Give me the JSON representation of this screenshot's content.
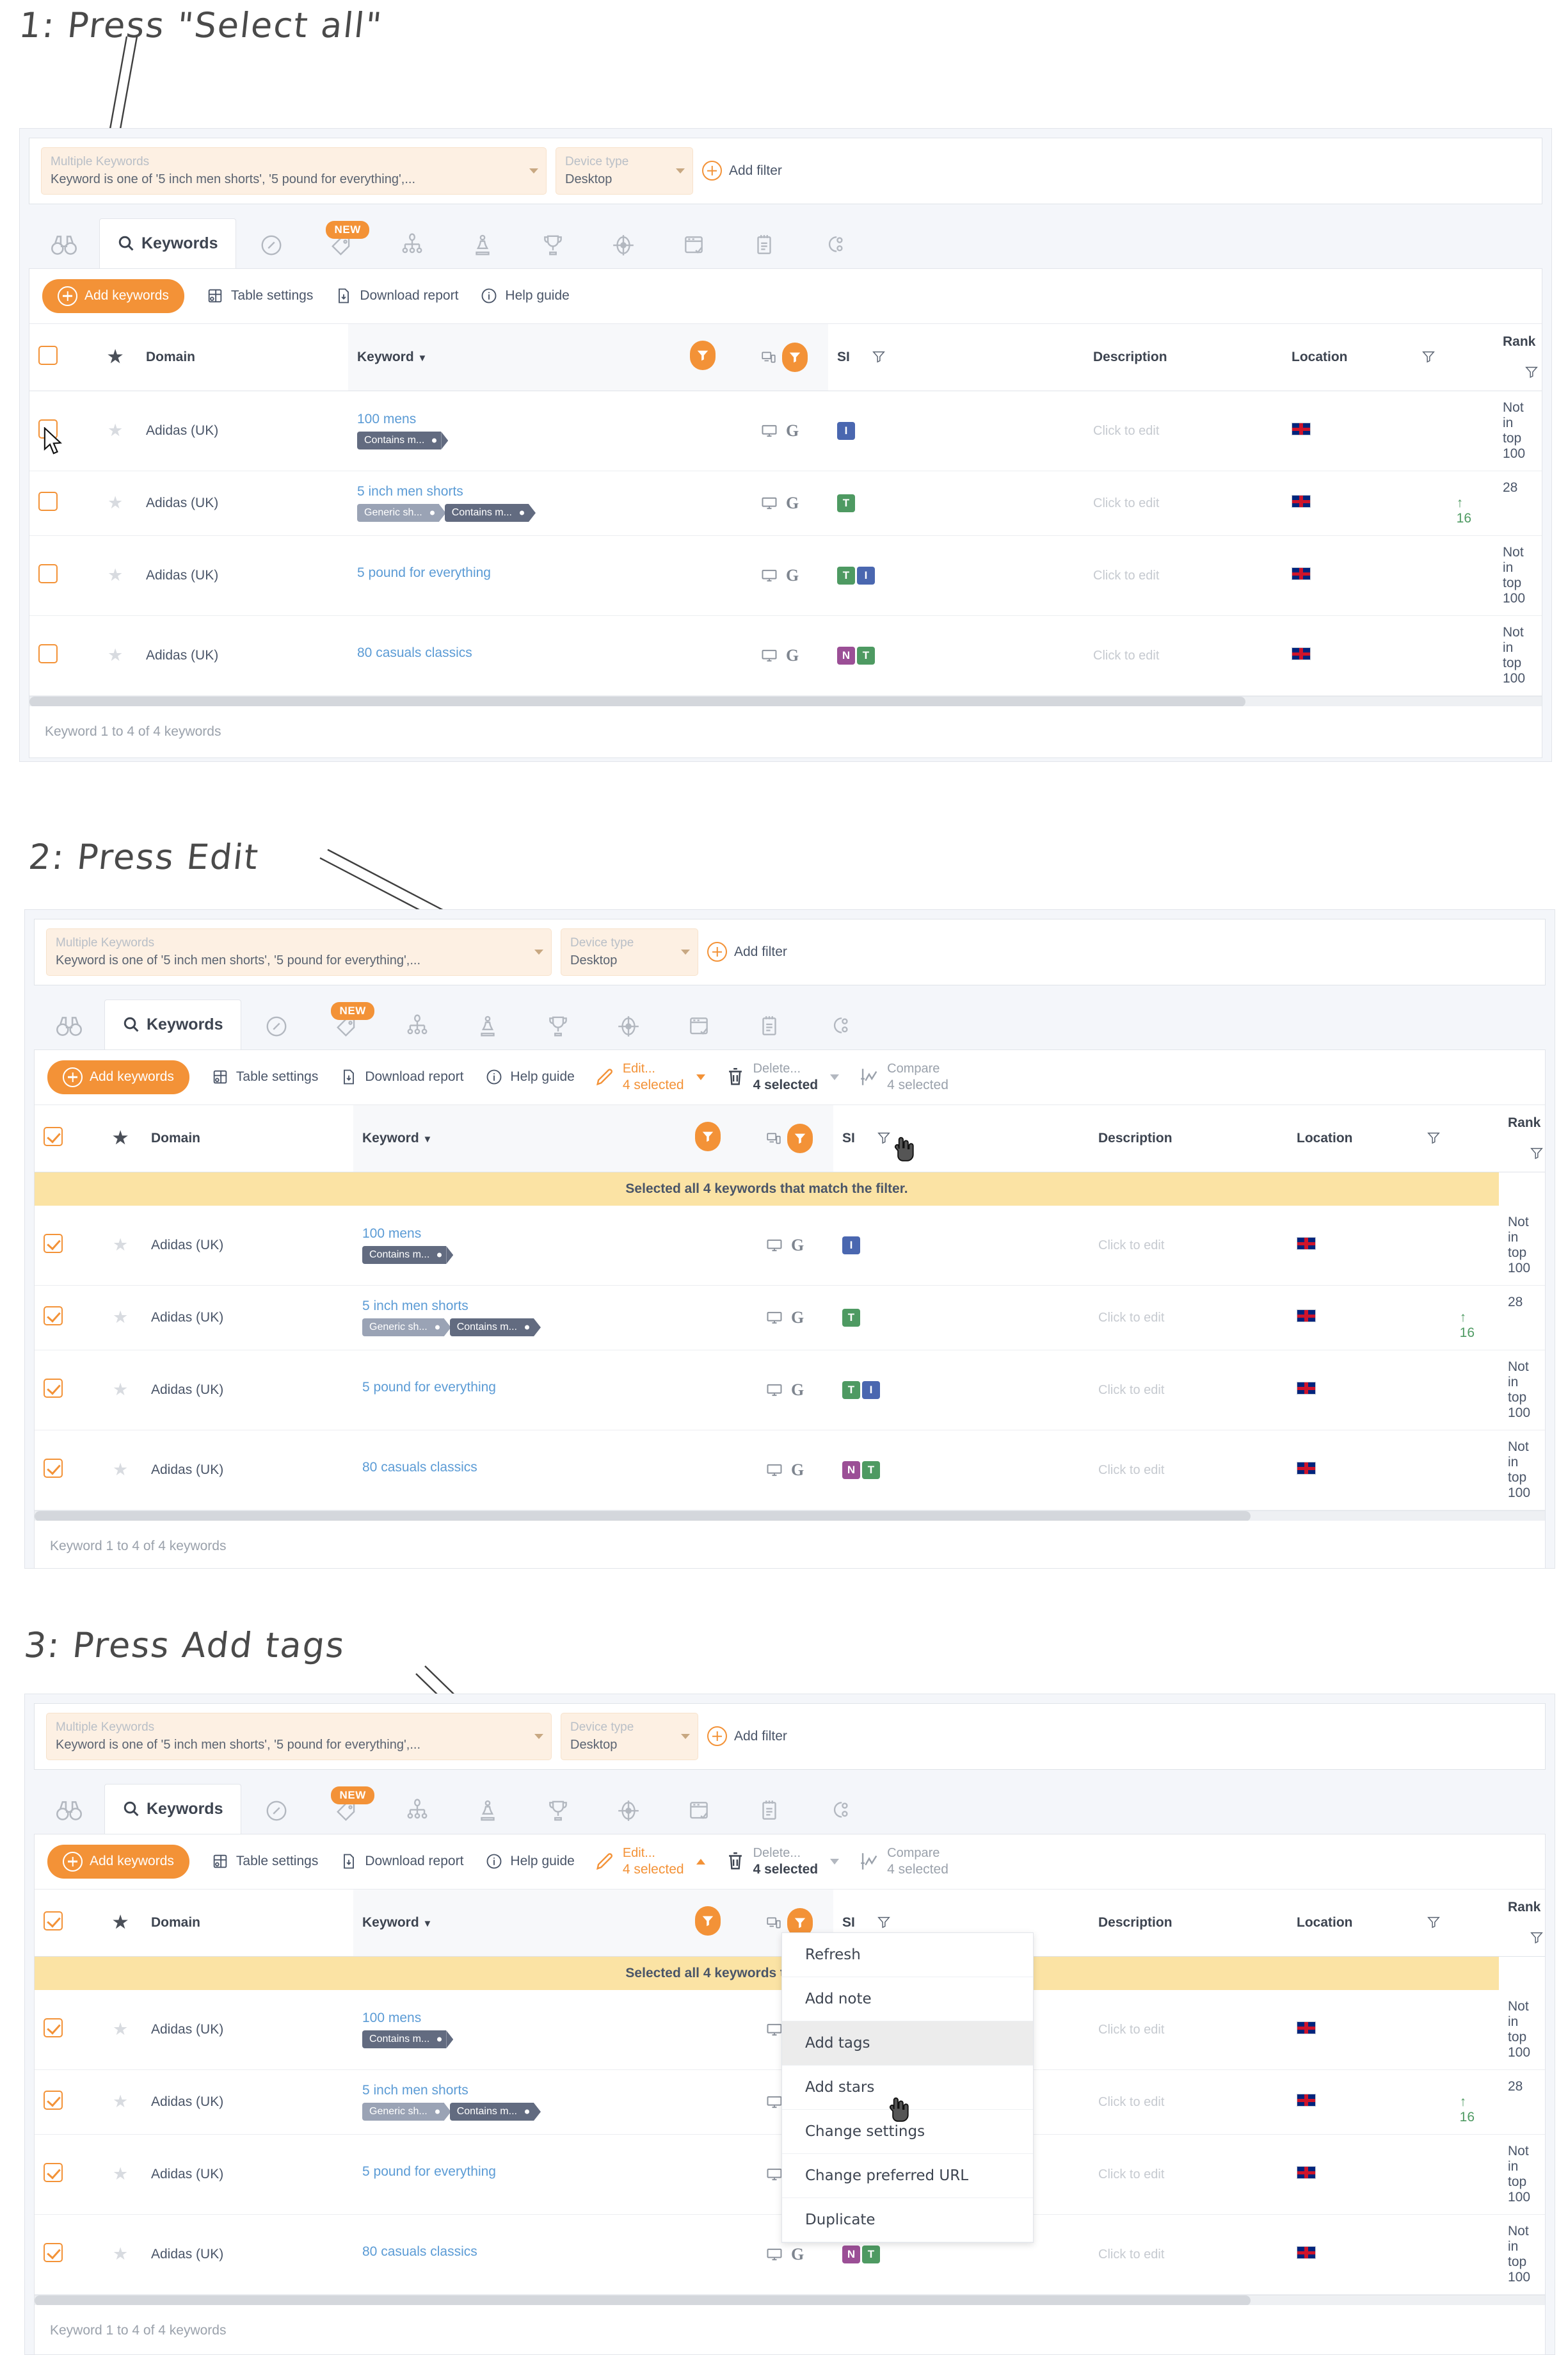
{
  "annotations": [
    {
      "text": "1: Press \"Select all\""
    },
    {
      "text": "2: Press Edit"
    },
    {
      "text": "3: Press Add tags"
    }
  ],
  "filter_bar": {
    "keyword_filter_label": "Multiple Keywords",
    "keyword_filter_value": "Keyword is one of '5 inch men shorts', '5 pound for everything',...",
    "device_filter_label": "Device type",
    "device_filter_value": "Desktop",
    "add_filter_label": "Add filter"
  },
  "tabs": {
    "active_label": "Keywords",
    "new_badge": "NEW",
    "icons": [
      "binoculars-icon",
      "search-icon",
      "compass-icon",
      "tag-icon",
      "sitemap-icon",
      "chess-pawn-icon",
      "trophy-icon",
      "target-icon",
      "browser-check-icon",
      "notepad-icon",
      "settings-gear-icon"
    ]
  },
  "toolbar": {
    "add_keywords": "Add keywords",
    "table_settings": "Table settings",
    "download_report": "Download report",
    "help_guide": "Help guide",
    "edit_label": "Edit...",
    "edit_count": "4 selected",
    "delete_label": "Delete...",
    "delete_count": "4 selected",
    "compare_label": "Compare",
    "compare_count": "4 selected"
  },
  "table": {
    "columns": [
      "Domain",
      "Keyword",
      "SI",
      "Description",
      "Location",
      "Rank",
      "+/-"
    ],
    "banner": "Selected all 4 keywords that match the filter.",
    "description_placeholder": "Click to edit",
    "footer": "Keyword 1 to 4 of 4 keywords",
    "rows": [
      {
        "domain": "Adidas (UK)",
        "keyword": "100 mens",
        "tags": [
          {
            "label": "Contains m...",
            "style": "dark"
          }
        ],
        "si": [
          "I"
        ],
        "description": "",
        "location": "UK",
        "rank": "Not in top 100",
        "delta": ""
      },
      {
        "domain": "Adidas (UK)",
        "keyword": "5 inch men shorts",
        "tags": [
          {
            "label": "Generic sh...",
            "style": "light"
          },
          {
            "label": "Contains m...",
            "style": "dark"
          }
        ],
        "si": [
          "T"
        ],
        "description": "",
        "location": "UK",
        "rank": "28",
        "delta": "16"
      },
      {
        "domain": "Adidas (UK)",
        "keyword": "5 pound for everything",
        "tags": [],
        "si": [
          "T",
          "I"
        ],
        "description": "",
        "location": "UK",
        "rank": "Not in top 100",
        "delta": ""
      },
      {
        "domain": "Adidas (UK)",
        "keyword": "80 casuals classics",
        "tags": [],
        "si": [
          "N",
          "T"
        ],
        "description": "",
        "location": "UK",
        "rank": "Not in top 100",
        "delta": ""
      }
    ]
  },
  "dropdown": {
    "items": [
      "Refresh",
      "Add note",
      "Add tags",
      "Add stars",
      "Change settings",
      "Change preferred URL",
      "Duplicate"
    ],
    "highlighted": "Add tags"
  },
  "colors": {
    "accent": "#f39237",
    "link": "#5b9bd5",
    "banner": "#fbe3a4",
    "positive": "#4e9a62",
    "panel_bg": "#f4f6fa"
  }
}
